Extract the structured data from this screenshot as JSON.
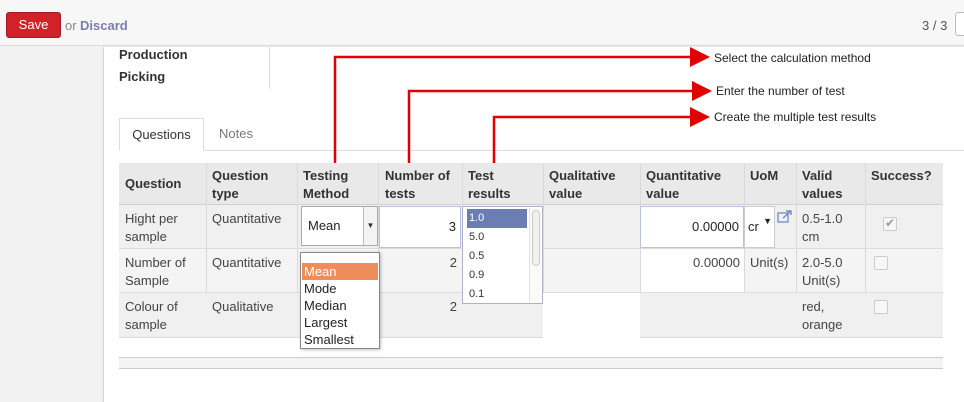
{
  "toolbar": {
    "save_label": "Save",
    "or_text": "or",
    "discard_label": "Discard",
    "pager": "3 / 3"
  },
  "form": {
    "field_production": "Production",
    "field_picking": "Picking"
  },
  "tabs": [
    {
      "label": "Questions",
      "active": true
    },
    {
      "label": "Notes",
      "active": false
    }
  ],
  "table": {
    "headers": {
      "question": [
        "Question"
      ],
      "question_type": [
        "Question",
        "type"
      ],
      "testing_method": [
        "Testing",
        "Method"
      ],
      "number_of_tests": [
        "Number of",
        "tests"
      ],
      "test_results": [
        "Test",
        "results"
      ],
      "qualitative_value": [
        "Qualitative",
        "value"
      ],
      "quantitative_value": [
        "Quantitative",
        "value"
      ],
      "uom": [
        "UoM"
      ],
      "valid_values": [
        "Valid",
        "values"
      ],
      "success": [
        "Success?"
      ]
    },
    "rows": [
      {
        "question": [
          "Hight per",
          "sample"
        ],
        "question_type": "Quantitative",
        "testing_method": "Mean",
        "number_of_tests": "3",
        "quantitative_value": "0.00000",
        "uom": "cr",
        "valid_values": [
          "0.5-1.0",
          "cm"
        ],
        "success": true
      },
      {
        "question": [
          "Number of",
          "Sample"
        ],
        "question_type": "Quantitative",
        "number_of_tests": "2",
        "quantitative_value": "0.00000",
        "uom": "Unit(s)",
        "valid_values": [
          "2.0-5.0",
          "Unit(s)"
        ],
        "success": false
      },
      {
        "question": [
          "Colour of",
          "sample"
        ],
        "question_type": "Qualitative",
        "number_of_tests": "2",
        "valid_values": [
          "red,",
          "orange"
        ],
        "success": false
      }
    ],
    "test_results_list": [
      "1.0",
      "5.0",
      "0.5",
      "0.9",
      "0.1"
    ],
    "test_results_selected": "1.0"
  },
  "method_dropdown": {
    "options": [
      "Mean",
      "Mode",
      "Median",
      "Largest",
      "Smallest"
    ],
    "highlighted": "Mean"
  },
  "annotations": {
    "calc_method": "Select the calculation method",
    "num_tests": "Enter the number of test",
    "multi_results": "Create the multiple test results"
  },
  "colors": {
    "save": "#d1222a",
    "discard": "#7c7bad",
    "arrow": "#e00000",
    "dropdown_highlight": "#ef8d5a",
    "list_selected": "#6a7eb4"
  }
}
